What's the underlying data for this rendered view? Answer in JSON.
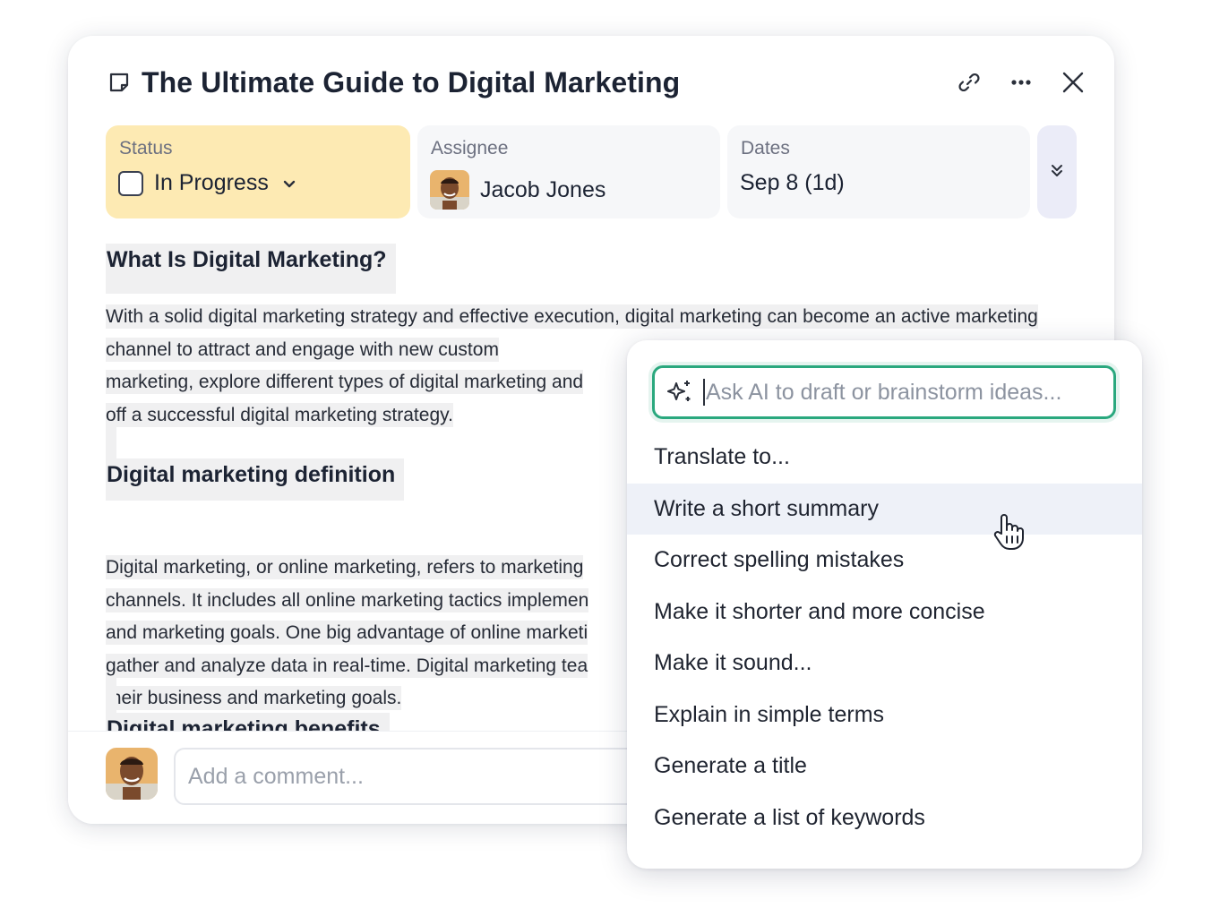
{
  "task": {
    "title": "The Ultimate Guide to Digital Marketing",
    "icons": {
      "doc": "doc-icon",
      "link": "link-icon",
      "more": "more-icon",
      "close": "close-icon"
    }
  },
  "fields": {
    "status": {
      "label": "Status",
      "value": "In Progress",
      "color": "#fdeab3"
    },
    "assignee": {
      "label": "Assignee",
      "name": "Jacob Jones"
    },
    "dates": {
      "label": "Dates",
      "value": "Sep 8 (1d)"
    }
  },
  "content": {
    "heading1": "What Is Digital Marketing?",
    "para1": "With a solid digital marketing strategy and effective execution, digital marketing can become an active marketing channel to attract and engage with new custom",
    "para1_line2_end": "marketing, explore different types of digital marketing and",
    "para1_line3": "off a successful digital marketing strategy.",
    "heading2": "Digital marketing definition",
    "para2_lines": [
      "Digital marketing, or online marketing, refers to marketing",
      "channels. It includes all online marketing tactics implemen",
      "and marketing goals. One big advantage of online marketi",
      "gather and analyze data in real-time. Digital marketing tea",
      "their business and marketing goals."
    ],
    "heading3": "Digital marketing benefits"
  },
  "comment": {
    "placeholder": "Add a comment..."
  },
  "ai_popup": {
    "placeholder": "Ask AI to draft or brainstorm ideas...",
    "accent": "#2aa87e",
    "items": [
      "Translate to...",
      "Write a short summary",
      "Correct spelling mistakes",
      "Make it shorter and more concise",
      "Make it sound...",
      "Explain in simple terms",
      "Generate a title",
      "Generate a list of keywords"
    ],
    "active_index": 1
  }
}
